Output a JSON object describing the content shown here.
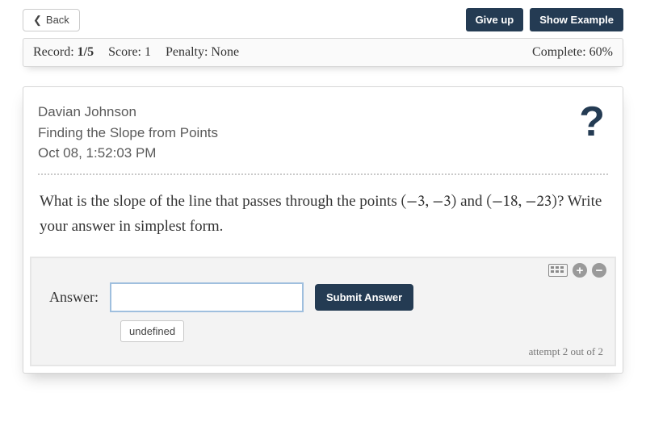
{
  "topbar": {
    "back_label": "Back",
    "giveup_label": "Give up",
    "example_label": "Show Example"
  },
  "status": {
    "record_label": "Record:",
    "record_value": "1/5",
    "score_label": "Score:",
    "score_value": "1",
    "penalty_label": "Penalty:",
    "penalty_value": "None",
    "complete_label": "Complete:",
    "complete_value": "60%"
  },
  "meta": {
    "student": "Davian Johnson",
    "topic": "Finding the Slope from Points",
    "timestamp": "Oct 08, 1:52:03 PM"
  },
  "question": {
    "prefix": "What is the slope of the line that passes through the points ",
    "p1": "(−3, −3)",
    "mid": " and ",
    "p2": "(−18, −23)",
    "suffix": "? Write your answer in simplest form."
  },
  "answer_area": {
    "label": "Answer:",
    "input_value": "",
    "submit_label": "Submit Answer",
    "undefined_label": "undefined",
    "attempt_text": "attempt 2 out of 2",
    "plus": "+",
    "minus": "−"
  },
  "help": {
    "glyph": "?"
  }
}
